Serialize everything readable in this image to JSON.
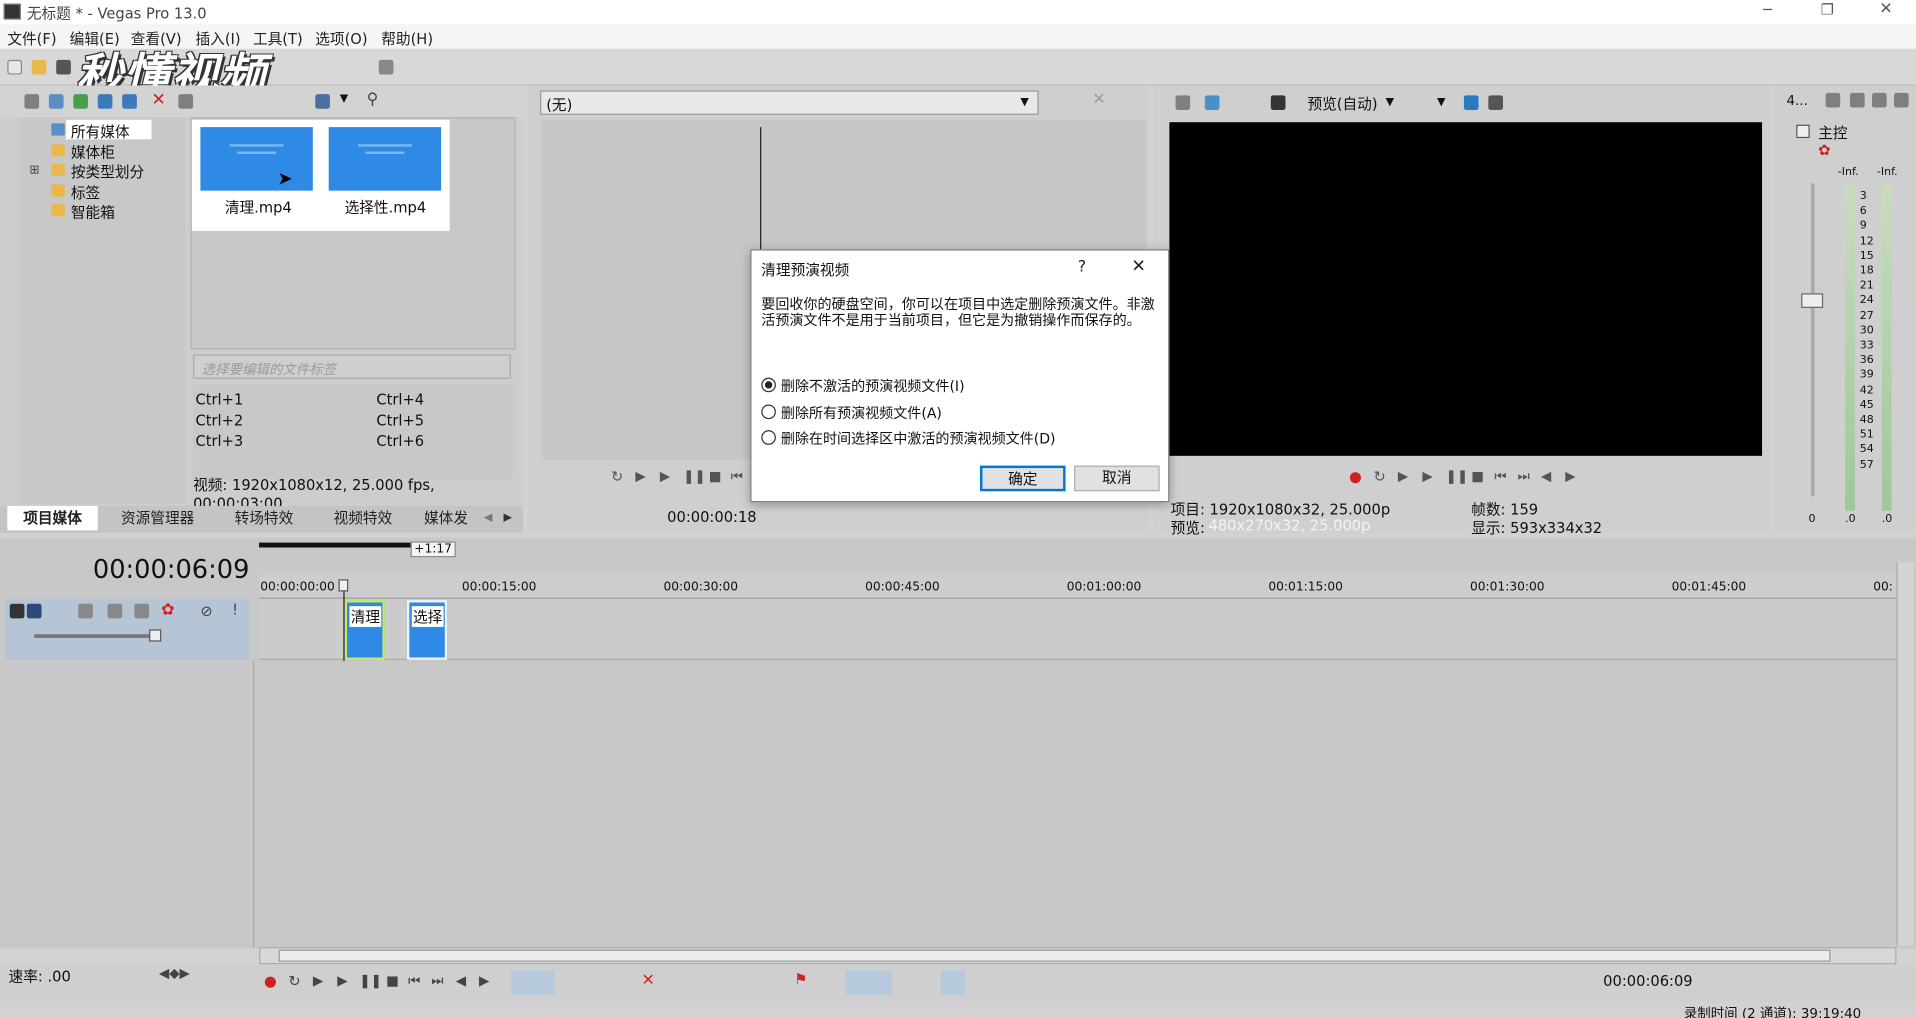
{
  "window": {
    "title": "无标题 * - Vegas Pro 13.0",
    "controls": [
      "─",
      "❐",
      "✕"
    ]
  },
  "menu": [
    "文件(F)",
    "编辑(E)",
    "查看(V)",
    "插入(I)",
    "工具(T)",
    "选项(O)",
    "帮助(H)"
  ],
  "watermark": "秒懂视频",
  "explorer": {
    "tree": [
      "所有媒体",
      "媒体柜",
      "按类型划分",
      "标签",
      "智能箱"
    ],
    "media": [
      {
        "name": "清理.mp4"
      },
      {
        "name": "选择性.mp4"
      }
    ],
    "tag_placeholder": "选择要编辑的文件标签",
    "shortcuts": [
      "Ctrl+1",
      "Ctrl+4",
      "Ctrl+2",
      "Ctrl+5",
      "Ctrl+3",
      "Ctrl+6"
    ],
    "info": "视频: 1920x1080x12, 25.000 fps, 00:00:03:00,",
    "tabs": [
      "项目媒体",
      "资源管理器",
      "转场特效",
      "视频特效",
      "媒体发"
    ]
  },
  "trimmer": {
    "dropdown": "(无)",
    "time": "00:00:00:18"
  },
  "preview": {
    "mode": "预览(自动)",
    "project": "项目: 1920x1080x32, 25.000p",
    "preview": "预览:",
    "preview_val": "480x270x32, 25.000p",
    "frames": "帧数: 159",
    "display": "显示: 593x334x32"
  },
  "mixer": {
    "label_prefix": "4...",
    "master": "主控",
    "inf": [
      "-Inf.",
      "-Inf."
    ],
    "scale": [
      "3",
      "6",
      "9",
      "12",
      "15",
      "18",
      "21",
      "24",
      "27",
      "30",
      "33",
      "36",
      "39",
      "42",
      "45",
      "48",
      "51",
      "54",
      "57"
    ],
    "bottom": [
      "0",
      ".0",
      ".0"
    ]
  },
  "timeline": {
    "time": "00:00:06:09",
    "loop": "+1:17",
    "ruler": [
      "00:00:00:00",
      "00:00:15:00",
      "00:00:30:00",
      "00:00:45:00",
      "00:01:00:00",
      "00:01:15:00",
      "00:01:30:00",
      "00:01:45:00",
      "00:"
    ],
    "clips": [
      "清理",
      "选择"
    ],
    "rate": "速率: .00",
    "cursor_time": "00:00:06:09",
    "status": "录制时间 (2 通道): 39:19:40"
  },
  "dialog": {
    "title": "清理预演视频",
    "help": "?",
    "close": "✕",
    "message": "要回收你的硬盘空间，你可以在项目中选定删除预演文件。非激活预演文件不是用于当前项目，但它是为撤销操作而保存的。",
    "options": [
      "删除不激活的预演视频文件(I)",
      "删除所有预演视频文件(A)",
      "删除在时间选择区中激活的预演视频文件(D)"
    ],
    "ok": "确定",
    "cancel": "取消"
  },
  "colors": {
    "accent": "#2f8ae6",
    "dialog_border": "#0078d7",
    "record": "#d02020"
  }
}
